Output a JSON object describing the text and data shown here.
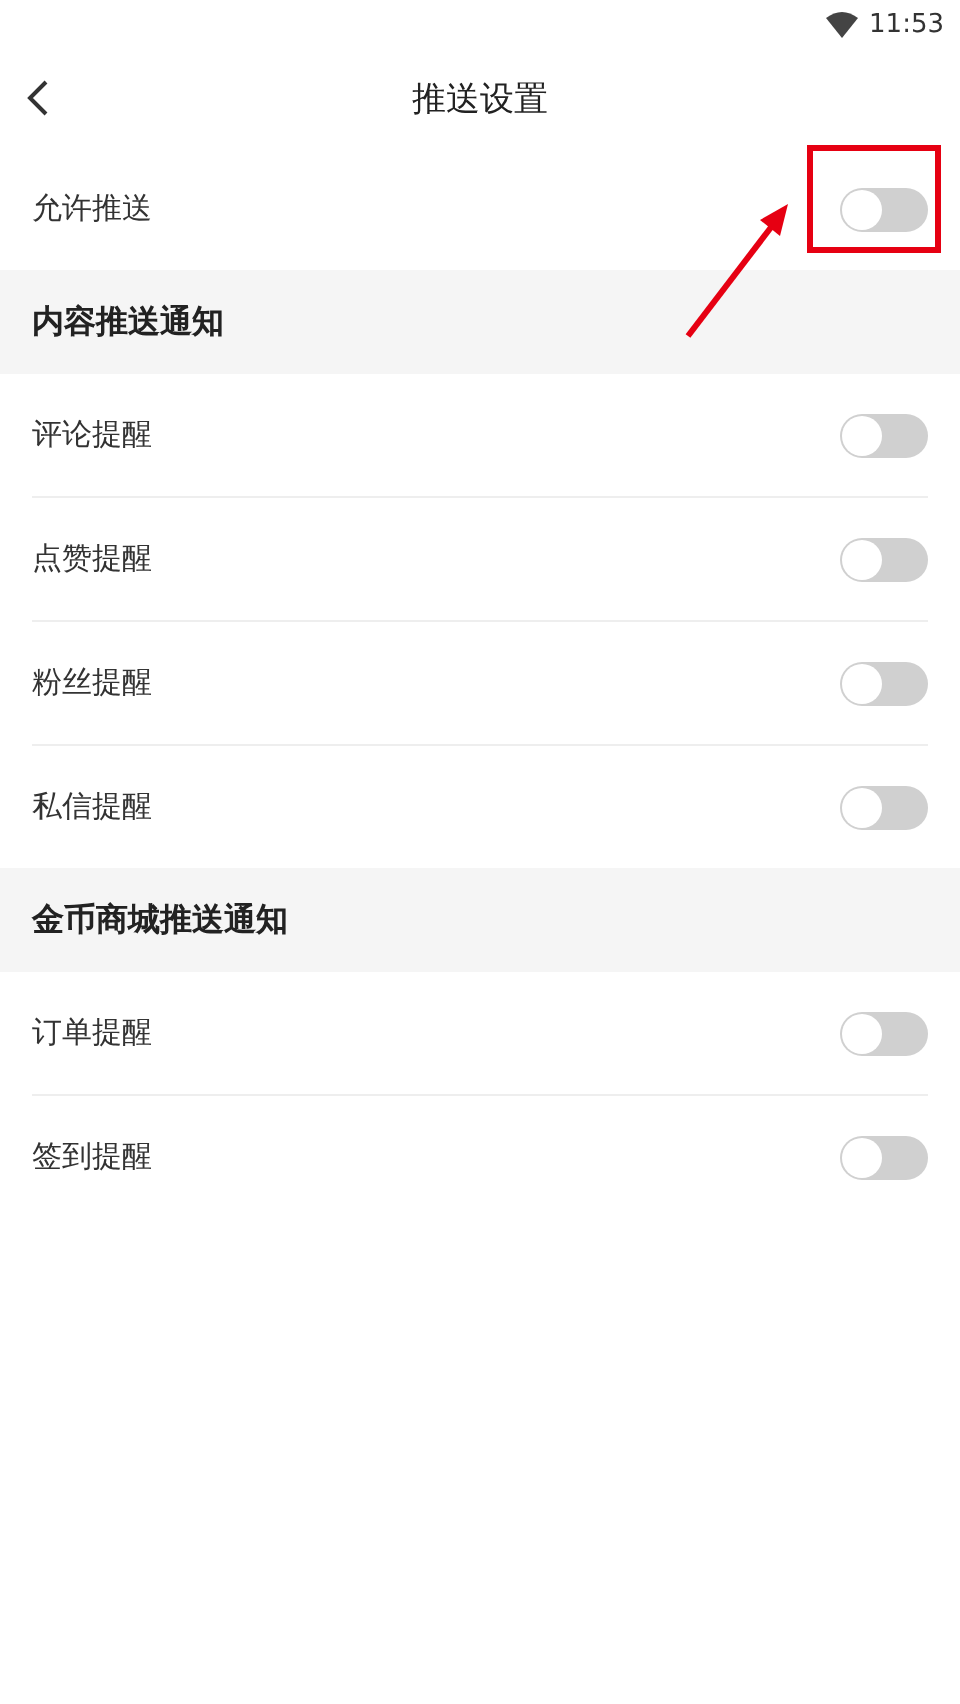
{
  "status_bar": {
    "time": "11:53"
  },
  "header": {
    "title": "推送设置"
  },
  "master": {
    "label": "允许推送",
    "on": false
  },
  "sections": [
    {
      "title": "内容推送通知",
      "items": [
        {
          "label": "评论提醒",
          "on": false
        },
        {
          "label": "点赞提醒",
          "on": false
        },
        {
          "label": "粉丝提醒",
          "on": false
        },
        {
          "label": "私信提醒",
          "on": false
        }
      ]
    },
    {
      "title": "金币商城推送通知",
      "items": [
        {
          "label": "订单提醒",
          "on": false
        },
        {
          "label": "签到提醒",
          "on": false
        }
      ]
    }
  ]
}
